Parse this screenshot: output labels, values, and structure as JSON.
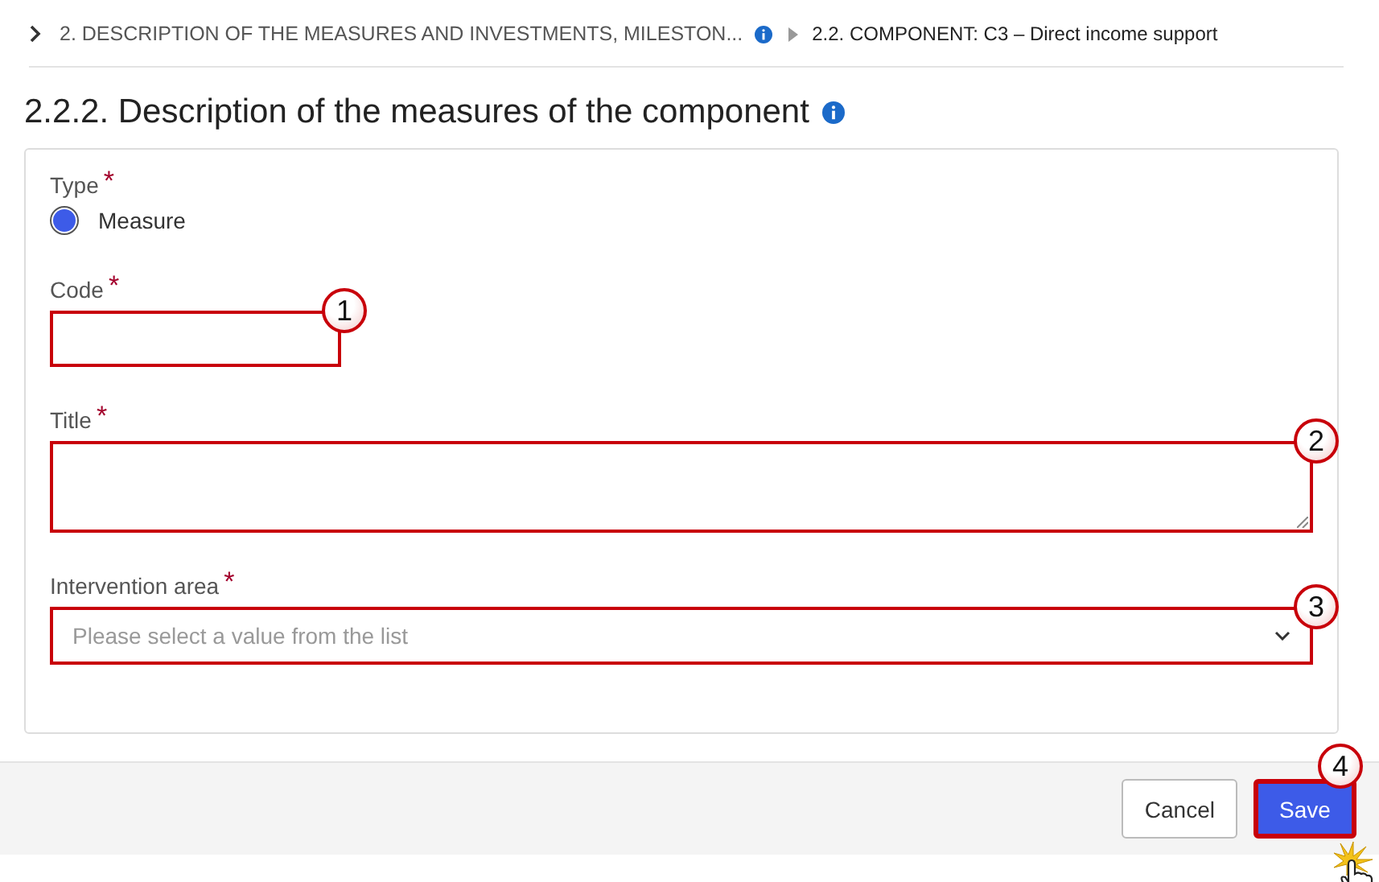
{
  "breadcrumb": [
    {
      "label": "2. DESCRIPTION OF THE MEASURES AND INVESTMENTS, MILESTON...",
      "info": true,
      "current": false
    },
    {
      "label": "2.2. COMPONENT: C3 – Direct income support",
      "info": false,
      "current": true
    }
  ],
  "heading": {
    "title": "2.2.2. Description of the measures of the component",
    "info": true
  },
  "fields": [
    {
      "kind": "radio",
      "label": "Type",
      "required_mark": "*",
      "options": [
        {
          "label": "Measure",
          "selected": true
        }
      ]
    },
    {
      "kind": "text",
      "label": "Code",
      "required_mark": "*",
      "callout": "1"
    },
    {
      "kind": "textarea",
      "label": "Title",
      "required_mark": "*",
      "callout": "2"
    },
    {
      "kind": "select",
      "label": "Intervention area",
      "required_mark": "*",
      "placeholder": "Please select a value from the list",
      "callout": "3"
    }
  ],
  "buttons": [
    {
      "label": "Cancel",
      "kind": "secondary"
    },
    {
      "label": "Save",
      "kind": "primary",
      "callout": "4"
    }
  ]
}
